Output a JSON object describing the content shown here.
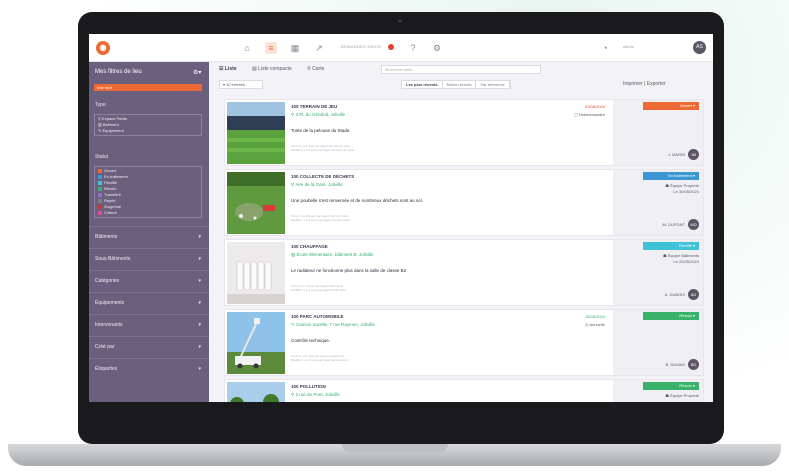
{
  "topbar": {
    "tag_label": "DEMANDES ENVOI",
    "user_label": "Alexis",
    "avatar_initials": "AS"
  },
  "sidebar": {
    "title": "Mes filtres de lieu",
    "orange_label": "Voir tout",
    "type_label": "Type",
    "type_options": [
      "Espace Public",
      "Bâtiment",
      "Équipement"
    ],
    "status_label": "Statut",
    "status_options": [
      {
        "label": "Ouvert",
        "color": "#ec6b34"
      },
      {
        "label": "En traitement",
        "color": "#3b97d3"
      },
      {
        "label": "Planifié",
        "color": "#3fc1d8"
      },
      {
        "label": "Résolu",
        "color": "#38b26a"
      },
      {
        "label": "Transféré",
        "color": "#9c6ad0"
      },
      {
        "label": "Rejeté",
        "color": "#7f7f7f"
      },
      {
        "label": "Supprimé",
        "color": "#c0392b"
      },
      {
        "label": "Clôturé",
        "color": "#e24a9c"
      }
    ],
    "sections": [
      "Bâtiments",
      "Sous-Bâtiments",
      "Catégories",
      "Équipements",
      "Intervenants",
      "Créé par",
      "Étiquettes"
    ]
  },
  "toolbar": {
    "tab_list": "Liste",
    "tab_compact": "Liste compacte",
    "tab_map": "Carte",
    "search_placeholder": "Rechercher dans...",
    "entries": "10 entrées",
    "sort_recent": "Les plus récents",
    "sort_old": "Moins récents",
    "sort_ref": "Par référence",
    "print": "Imprimer | Exporter"
  },
  "cards": [
    {
      "num": "100",
      "title": "TERRAIN DE JEU",
      "location": "3 Pl. du Général, Joliville",
      "description": "Tonte de la pelouse du Stade.",
      "meta1": "Créé il y a 6 mois par Agent Service de voirie",
      "meta2": "Modifié il y a 3 jours par Agent Service de voirie",
      "date": "02/06/2024",
      "assign": "Hebdomadaire",
      "status": "Ouvert",
      "status_color": "#ec6b34",
      "team": "",
      "team_date": "",
      "person": "J. MARIN",
      "person_initials": "JM"
    },
    {
      "num": "100",
      "title": "COLLECTE DE DÉCHETS",
      "location": "Aire de la Gare, Joliville",
      "description": "Une poubelle s'est renversée et de nombreux déchets sont au sol.",
      "meta1": "Créé il y a 20 jours par Agent Service Voirie",
      "meta2": "Modifié il y a 3 jours par Agent Service Voirie",
      "date": "",
      "assign": "",
      "status": "En traitement",
      "status_color": "#3b97d3",
      "team": "Équipe Propreté",
      "team_date": "Le 30/05/2024",
      "person": "M. DUPONT",
      "person_initials": "MD"
    },
    {
      "num": "100",
      "title": "CHAUFFAGE",
      "location": "École élémentaire, bâtiment B, Joliville",
      "description": "Le radiateur ne fonctionne plus dans la salle de classe B2.",
      "meta1": "Créé il y a 7 jours par Agent Patrimoine",
      "meta2": "Modifié il y a 2 jours par Agent Patrimoine",
      "date": "",
      "assign": "",
      "status": "Planifié",
      "status_color": "#3fc1d8",
      "team": "Équipe Bâtiments",
      "team_date": "Le 22/05/2024",
      "person": "A. DUBOIS",
      "person_initials": "AD"
    },
    {
      "num": "100",
      "title": "PARC AUTOMOBILE",
      "location": "Camion nacelle, 7 rue Raymon, Joliville",
      "description": "Contrôle technique.",
      "meta1": "Créé il y a 5 mois par Agent équipement",
      "meta2": "Modifié il y a 3 mois par Agent équipement",
      "date": "15/05/2024",
      "assign": "Annuelle",
      "status": "Résolu",
      "status_color": "#38b26a",
      "team": "",
      "team_date": "",
      "person": "B. DUMAS",
      "person_initials": "BD"
    },
    {
      "num": "100",
      "title": "POLLUTION",
      "location": "2 rue du Pont, Joliville",
      "description": "",
      "meta1": "",
      "meta2": "",
      "date": "",
      "assign": "",
      "status": "Résolu",
      "status_color": "#38b26a",
      "team": "Équipe Propreté",
      "team_date": "",
      "person": "",
      "person_initials": ""
    }
  ]
}
